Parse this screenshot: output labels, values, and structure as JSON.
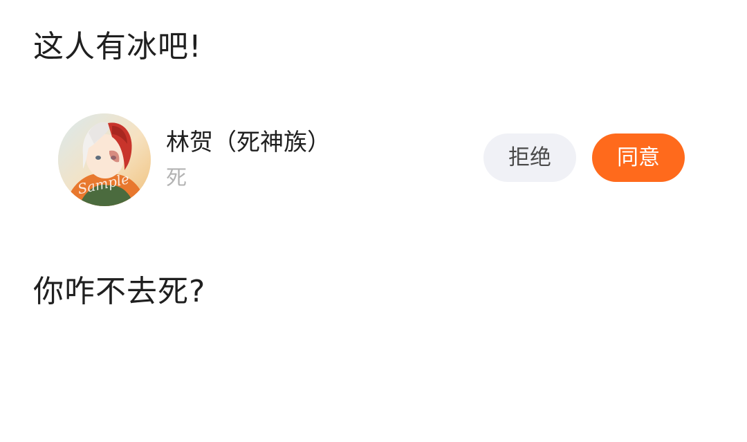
{
  "captions": {
    "top": "这人有冰吧!",
    "bottom": "你咋不去死?"
  },
  "request": {
    "name": "林贺（死神族）",
    "subtitle": "死",
    "avatar_watermark": "Sample",
    "reject_label": "拒绝",
    "accept_label": "同意"
  },
  "colors": {
    "accent": "#ff6a1c",
    "reject_bg": "#f0f1f6",
    "subtitle": "#b3b3b3"
  }
}
